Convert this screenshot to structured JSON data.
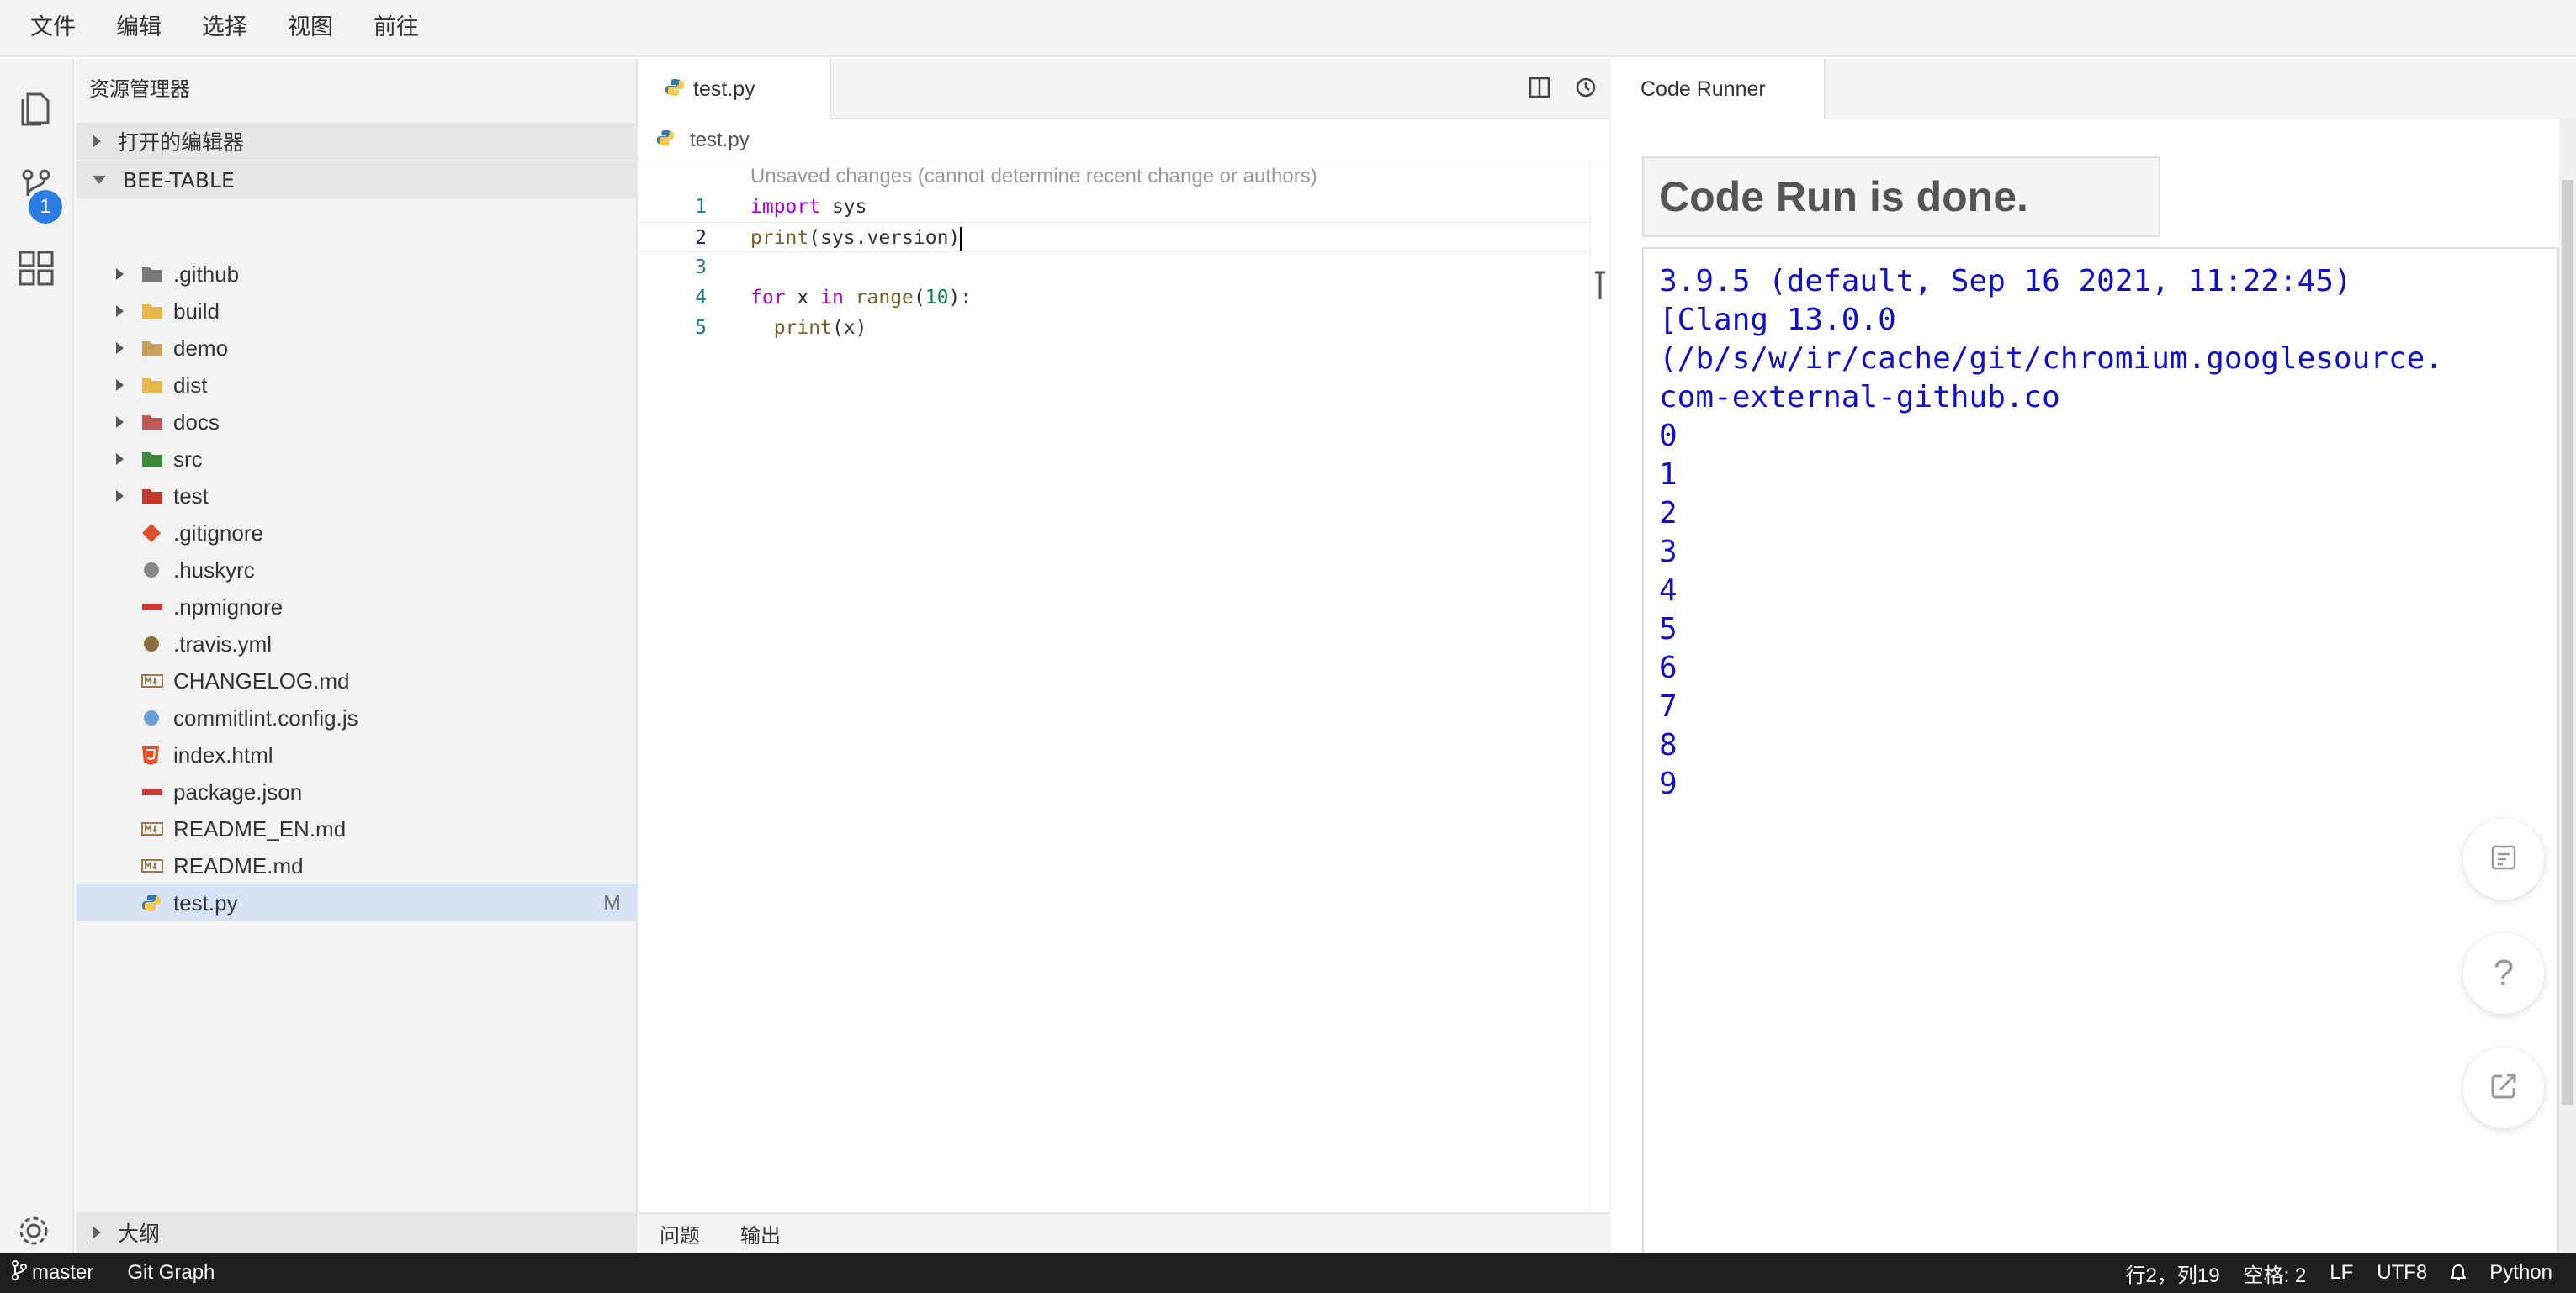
{
  "menu": [
    "文件",
    "编辑",
    "选择",
    "视图",
    "前往"
  ],
  "activity_bar": {
    "scm_badge": "1"
  },
  "sidebar": {
    "title": "资源管理器",
    "open_editors": "打开的编辑器",
    "project": "BEE-TABLE",
    "files": [
      {
        "name": ".github",
        "type": "folder",
        "icon": "github-folder-icon",
        "color": "#7a7a7a"
      },
      {
        "name": "build",
        "type": "folder",
        "icon": "build-folder-icon",
        "color": "#e8b84a"
      },
      {
        "name": "demo",
        "type": "folder",
        "icon": "folder-icon",
        "color": "#c9a15a"
      },
      {
        "name": "dist",
        "type": "folder",
        "icon": "dist-folder-icon",
        "color": "#e8b84a"
      },
      {
        "name": "docs",
        "type": "folder",
        "icon": "docs-folder-icon",
        "color": "#c05a5a"
      },
      {
        "name": "src",
        "type": "folder",
        "icon": "src-folder-icon",
        "color": "#3a8a3a"
      },
      {
        "name": "test",
        "type": "folder",
        "icon": "test-folder-icon",
        "color": "#c0392b"
      },
      {
        "name": ".gitignore",
        "type": "file",
        "icon": "git-icon",
        "color": "#e0502f"
      },
      {
        "name": ".huskyrc",
        "type": "file",
        "icon": "husky-icon",
        "color": "#888888"
      },
      {
        "name": ".npmignore",
        "type": "file",
        "icon": "npm-icon",
        "color": "#cb3837"
      },
      {
        "name": ".travis.yml",
        "type": "file",
        "icon": "travis-icon",
        "color": "#8a6d3b"
      },
      {
        "name": "CHANGELOG.md",
        "type": "file",
        "icon": "markdown-icon",
        "color": "#9a7b4f"
      },
      {
        "name": "commitlint.config.js",
        "type": "file",
        "icon": "commitlint-icon",
        "color": "#6aa0d8"
      },
      {
        "name": "index.html",
        "type": "file",
        "icon": "html5-icon",
        "color": "#e44d26"
      },
      {
        "name": "package.json",
        "type": "file",
        "icon": "npm-icon",
        "color": "#cb3837"
      },
      {
        "name": "README_EN.md",
        "type": "file",
        "icon": "markdown-icon",
        "color": "#9a7b4f"
      },
      {
        "name": "README.md",
        "type": "file",
        "icon": "markdown-icon",
        "color": "#9a7b4f"
      },
      {
        "name": "test.py",
        "type": "file",
        "icon": "python-icon",
        "color": "#3776ab",
        "status": "M",
        "selected": true
      }
    ],
    "outline": "大纲"
  },
  "editor": {
    "tab_label": "test.py",
    "breadcrumb": "test.py",
    "codelens": "Unsaved changes (cannot determine recent change or authors)",
    "lines": [
      {
        "n": "1",
        "parts": [
          [
            "kw",
            "import"
          ],
          [
            "",
            " sys"
          ]
        ]
      },
      {
        "n": "2",
        "parts": [
          [
            "fn",
            "print"
          ],
          [
            "",
            "(sys.version)"
          ]
        ],
        "current": true
      },
      {
        "n": "3",
        "parts": []
      },
      {
        "n": "4",
        "parts": [
          [
            "kw",
            "for"
          ],
          [
            "",
            " x "
          ],
          [
            "kw",
            "in"
          ],
          [
            "",
            " "
          ],
          [
            "fn",
            "range"
          ],
          [
            "",
            "("
          ],
          [
            "num",
            "10"
          ],
          [
            "",
            "):"
          ]
        ]
      },
      {
        "n": "5",
        "parts": [
          [
            "",
            "  "
          ],
          [
            "fn",
            "print"
          ],
          [
            "",
            "(x)"
          ]
        ]
      }
    ]
  },
  "panel_tabs": [
    "问题",
    "输出"
  ],
  "runner": {
    "tab_label": "Code Runner",
    "status": "Code Run is done.",
    "output_lines": [
      "3.9.5 (default, Sep 16 2021, 11:22:45)",
      "[Clang 13.0.0",
      "(/b/s/w/ir/cache/git/chromium.googlesource.",
      "com-external-github.co",
      "0",
      "1",
      "2",
      "3",
      "4",
      "5",
      "6",
      "7",
      "8",
      "9"
    ]
  },
  "statusbar": {
    "branch": "master",
    "git_graph": "Git Graph",
    "position": "行2，列19",
    "spaces": "空格: 2",
    "eol": "LF",
    "encoding": "UTF8",
    "language": "Python"
  },
  "colors": {
    "accent": "#2f7be4",
    "statusbar_bg": "#1e1e1e",
    "output_text": "#1010cc",
    "selection": "#d6e4f5"
  }
}
